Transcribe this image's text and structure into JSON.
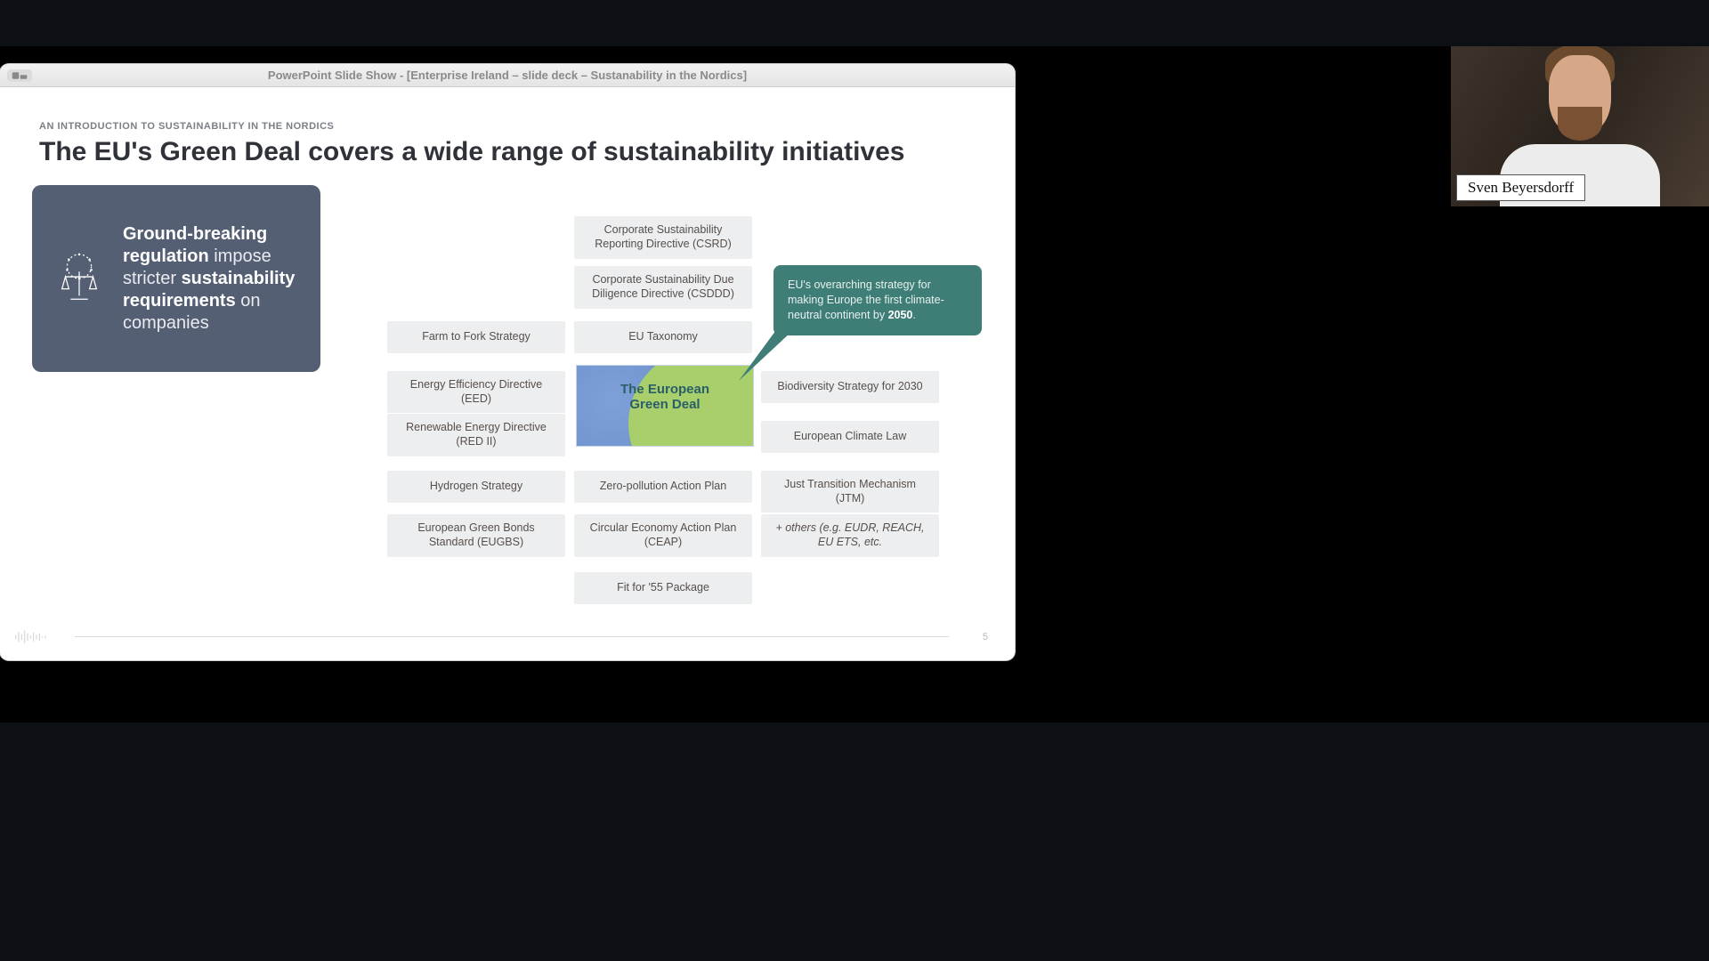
{
  "window": {
    "title": "PowerPoint Slide Show - [Enterprise Ireland – slide deck – Sustanability in the Nordics]"
  },
  "slide": {
    "eyebrow": "AN INTRODUCTION TO SUSTAINABILITY IN THE NORDICS",
    "headline": "The EU's Green Deal covers a wide range of sustainability initiatives",
    "page_number": "5",
    "hero": {
      "line1_bold": "Ground-breaking regulation",
      "line1_rest": " impose stricter ",
      "line2_bold": "sustainability requirements",
      "line2_rest": " on companies"
    },
    "callout": {
      "text_a": "EU's overarching strategy for making Europe the first climate-neutral continent by ",
      "text_bold": "2050",
      "text_b": "."
    },
    "center_tile": "The European\nGreen Deal",
    "items": {
      "csrd": "Corporate Sustainability Reporting Directive (CSRD)",
      "csddd": "Corporate Sustainability Due Diligence Directive (CSDDD)",
      "farm_fork": "Farm to Fork Strategy",
      "eu_taxonomy": "EU Taxonomy",
      "eed": "Energy Efficiency Directive (EED)",
      "biodiversity": "Biodiversity Strategy for 2030",
      "red2": "Renewable Energy Directive (RED II)",
      "climate_law": "European Climate Law",
      "hydrogen": "Hydrogen Strategy",
      "zero_pollution": "Zero-pollution Action Plan",
      "jtm": "Just Transition Mechanism (JTM)",
      "eugbs": "European Green Bonds Standard (EUGBS)",
      "ceap": "Circular Economy Action Plan (CEAP)",
      "others": "+ others (e.g. EUDR, REACH, EU ETS, etc.",
      "fit55": "Fit for '55 Package"
    }
  },
  "webcam": {
    "speaker_name": "Sven Beyersdorff"
  }
}
